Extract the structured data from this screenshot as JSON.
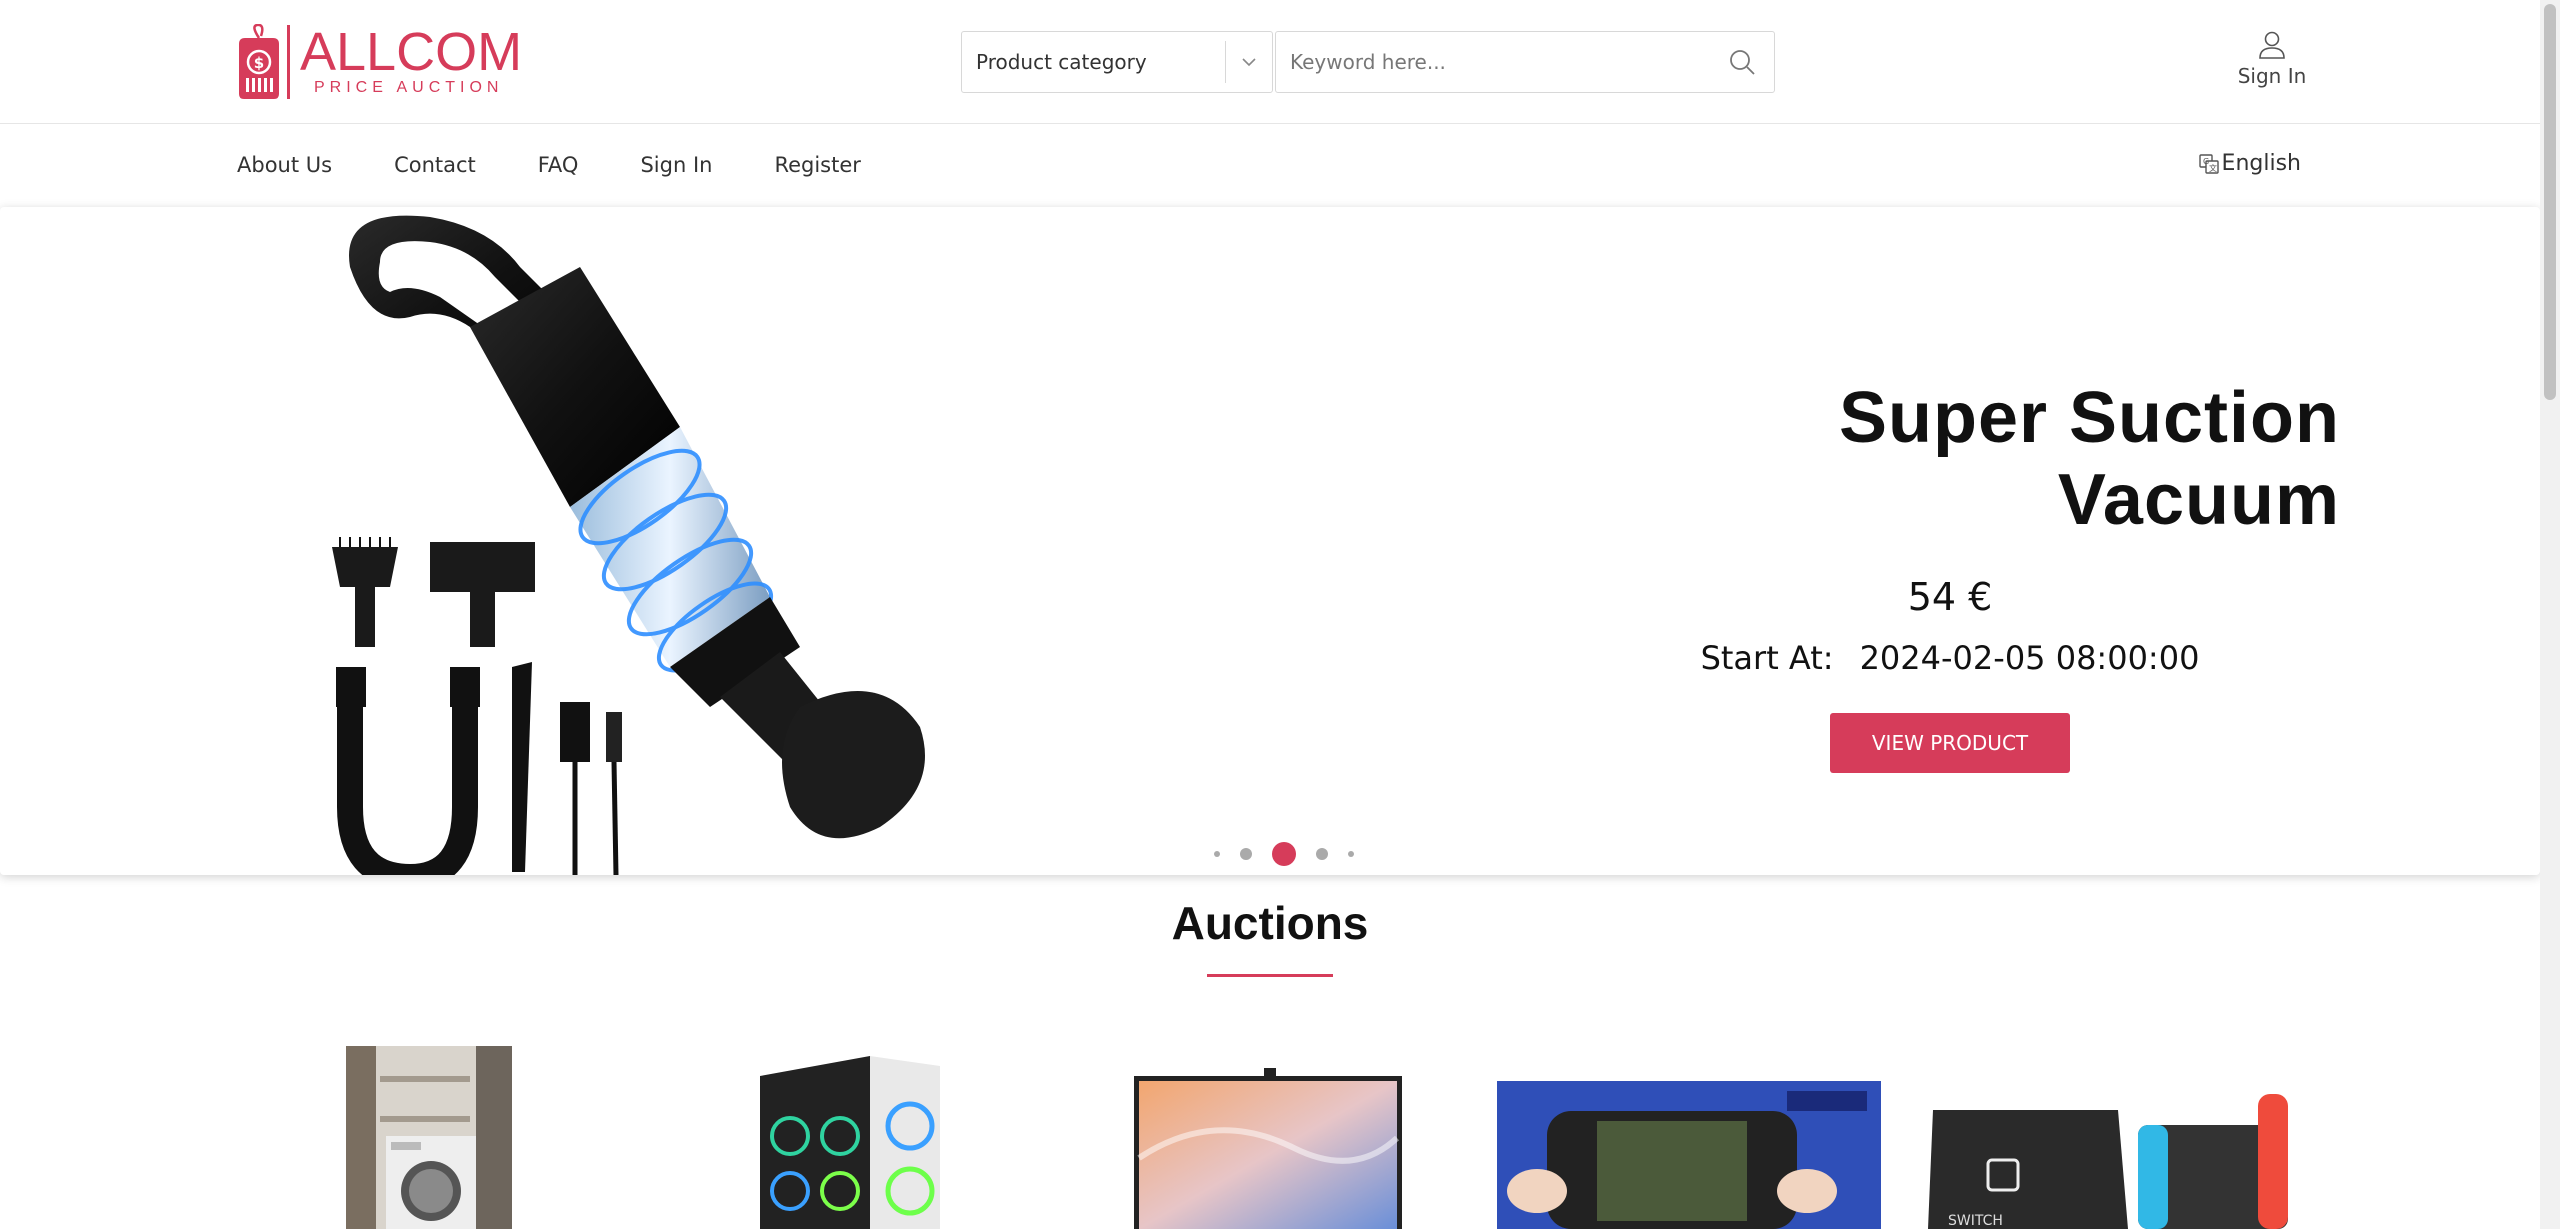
{
  "logo": {
    "title": "ALLCOM",
    "subtitle": "PRICE AUCTION",
    "brand_color": "#d63c5a"
  },
  "search": {
    "category_label": "Product category",
    "keyword_placeholder": "Keyword here..."
  },
  "header": {
    "signin_label": "Sign In"
  },
  "nav": {
    "links": [
      "About Us",
      "Contact",
      "FAQ",
      "Sign In",
      "Register"
    ],
    "language": "English"
  },
  "hero": {
    "title": "Super Suction Vacuum",
    "price": "54 €",
    "start_label": "Start At:",
    "start_value": "2024-02-05 08:00:00",
    "button_label": "VIEW PRODUCT",
    "slides_total": 5,
    "active_slide": 3
  },
  "auctions": {
    "title": "Auctions",
    "items": [
      {
        "image": "washing-machine-image"
      },
      {
        "image": "gaming-pc-image"
      },
      {
        "image": "monitor-image"
      },
      {
        "image": "handheld-console-image"
      },
      {
        "image": "nintendo-switch-image"
      }
    ]
  }
}
